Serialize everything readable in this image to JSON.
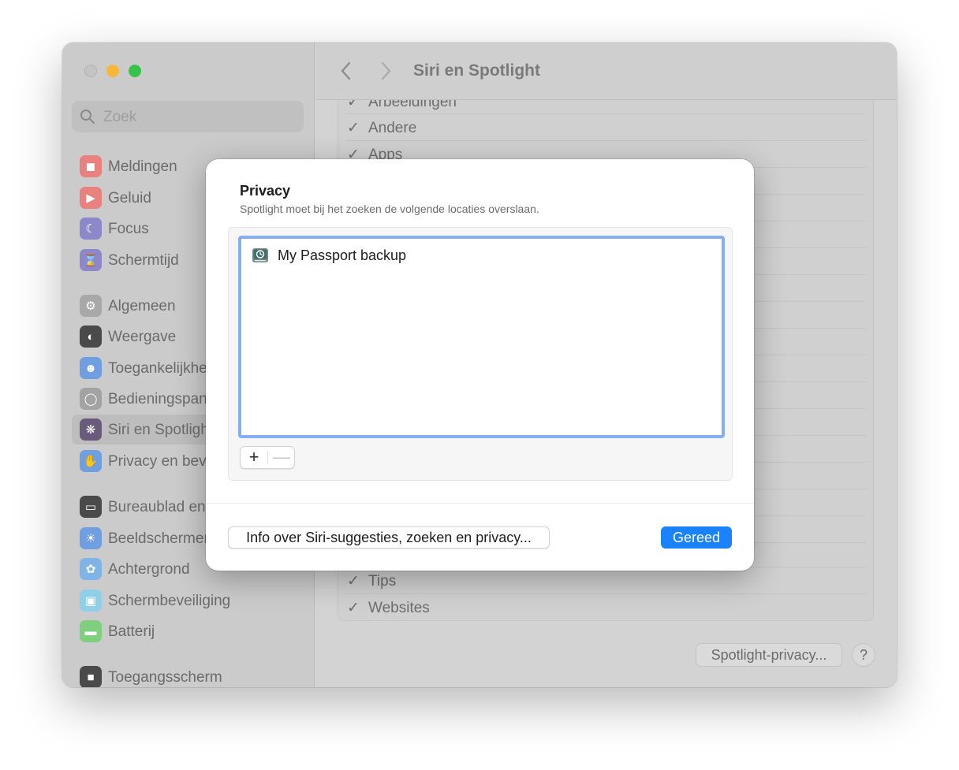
{
  "window": {
    "title": "Siri en Spotlight"
  },
  "search": {
    "placeholder": "Zoek"
  },
  "sidebar": {
    "items": [
      {
        "label": "Meldingen",
        "icon": "bell-icon",
        "color": "#e9827f"
      },
      {
        "label": "Geluid",
        "icon": "speaker-icon",
        "color": "#e9827f"
      },
      {
        "label": "Focus",
        "icon": "moon-icon",
        "color": "#8c88c9"
      },
      {
        "label": "Schermtijd",
        "icon": "hourglass-icon",
        "color": "#8c88c9"
      },
      {
        "label": "Algemeen",
        "icon": "gear-icon",
        "color": "#a8a8a8"
      },
      {
        "label": "Weergave",
        "icon": "appearance-icon",
        "color": "#4a4a4a"
      },
      {
        "label": "Toegankelijkhe",
        "icon": "accessibility-icon",
        "color": "#6f9fe0"
      },
      {
        "label": "Bedieningspan",
        "icon": "toggles-icon",
        "color": "#a3a3a3"
      },
      {
        "label": "Siri en Spotligh",
        "icon": "siri-icon",
        "color": "#6a5a7c"
      },
      {
        "label": "Privacy en bev",
        "icon": "hand-icon",
        "color": "#6f9fe0"
      },
      {
        "label": "Bureaublad en",
        "icon": "dock-icon",
        "color": "#4a4a4a"
      },
      {
        "label": "Beeldschermen",
        "icon": "sun-icon",
        "color": "#6f9fe0"
      },
      {
        "label": "Achtergrond",
        "icon": "flower-icon",
        "color": "#7fb5e6"
      },
      {
        "label": "Schermbeveiliging",
        "icon": "screensaver-icon",
        "color": "#8fd0e8"
      },
      {
        "label": "Batterij",
        "icon": "battery-icon",
        "color": "#7fcf7f"
      },
      {
        "label": "Toegangsscherm",
        "icon": "lock-icon",
        "color": "#4a4a4a"
      }
    ]
  },
  "categories": [
    {
      "label": "Arbeeldingen"
    },
    {
      "label": "Andere"
    },
    {
      "label": "Apps"
    },
    {
      "label": "Tips"
    },
    {
      "label": "Websites"
    }
  ],
  "footer": {
    "spotlight_privacy": "Spotlight-privacy...",
    "help": "?"
  },
  "dialog": {
    "title": "Privacy",
    "subtitle": "Spotlight moet bij het zoeken de volgende locaties overslaan.",
    "items": [
      {
        "label": "My Passport backup",
        "icon": "time-machine-drive-icon"
      }
    ],
    "plus": "+",
    "minus": "—",
    "info_button": "Info over Siri-suggesties, zoeken en privacy...",
    "done_button": "Gereed"
  }
}
